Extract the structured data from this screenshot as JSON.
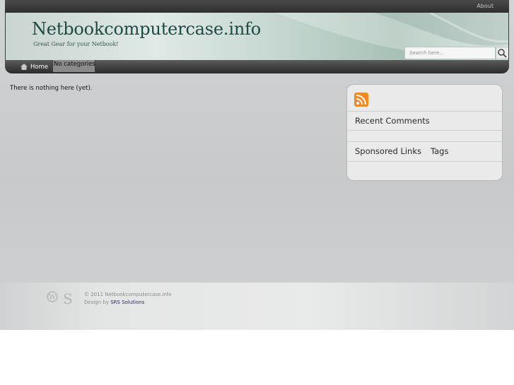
{
  "topbar": {
    "about_label": "About"
  },
  "header": {
    "site_title": "Netbookcomputercase.info",
    "tagline": "Great Gear for your Netbook!",
    "search": {
      "placeholder": "Search here...",
      "button_icon": "search-icon"
    }
  },
  "nav": {
    "items": [
      {
        "label": "Home",
        "icon": "home-icon"
      },
      {
        "label": "No categories"
      }
    ]
  },
  "main": {
    "message": "There is nothing here (yet)."
  },
  "sidebar": {
    "rss_icon": "rss-icon",
    "recent_comments_title": "Recent Comments",
    "sponsored_links_title": "Sponsored Links",
    "tags_title": "Tags"
  },
  "footer": {
    "copyright": "© 2011 Netbookcomputercase.info",
    "design_prefix": "Design by",
    "design_link": "SRS Solutions",
    "icons": [
      "wordpress-icon",
      "srs-logo-icon"
    ]
  },
  "colors": {
    "title": "#1f4a44",
    "nav_bg": "#2b2b2b",
    "rss": "#f28a1c"
  }
}
